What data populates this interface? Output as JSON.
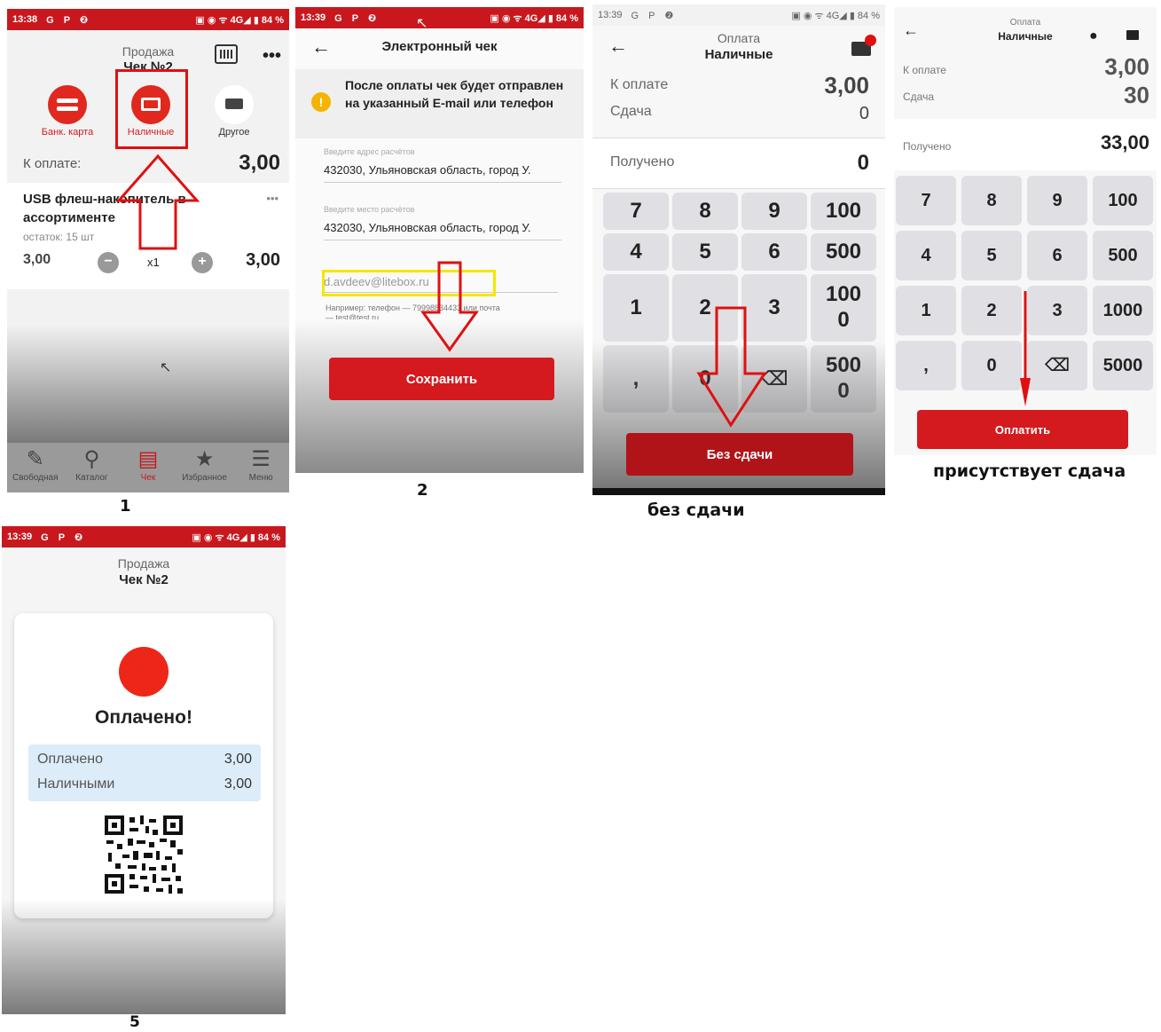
{
  "panel1": {
    "status_time": "13:38",
    "status_icons": "G P ❷",
    "status_right": "▣ ◉ ᯤ 4G◢ ▮ 84 %",
    "title": "Продажа",
    "subtitle": "Чек №2",
    "payment_methods": [
      "Банк. карта",
      "Наличные",
      "Другое"
    ],
    "to_pay_label": "К оплате:",
    "to_pay_value": "3,00",
    "item_name": "USB флеш-накопитель в ассортименте",
    "item_stock": "остаток: 15 шт",
    "item_price": "3,00",
    "item_qty": "x1",
    "item_total": "3,00",
    "tabs": [
      "Свободная",
      "Каталог",
      "Чек",
      "Избранное",
      "Меню"
    ],
    "caption": "1"
  },
  "panel2": {
    "status_time": "13:39",
    "status_icons": "G P ❷",
    "status_right": "▣ ◉ ᯤ 4G◢ ▮ 84 %",
    "title": "Электронный чек",
    "notice": "После оплаты чек будет отправлен на указанный E-mail или телефон",
    "field1_label": "Введите адрес расчётов",
    "field1_value": "432030, Ульяновская область, город У.",
    "field2_label": "Введите место расчётов",
    "field2_value": "432030, Ульяновская область, город У.",
    "email_value": "d.avdeev@litebox.ru",
    "hint": "Например: телефон — 79998834433 или почта — test@test.ru",
    "save_button": "Сохранить",
    "caption": "2"
  },
  "panel3": {
    "status_time": "13:39",
    "status_icons": "G P ❷",
    "status_right": "▣ ◉ ᯤ 4G◢ ▮ 84 %",
    "title": "Оплата",
    "subtitle": "Наличные",
    "to_pay_label": "К оплате",
    "to_pay_value": "3,00",
    "change_label": "Сдача",
    "change_value": "0",
    "received_label": "Получено",
    "received_value": "0",
    "keys": [
      "7",
      "8",
      "9",
      "100",
      "4",
      "5",
      "6",
      "500",
      "1",
      "2",
      "3",
      "1000",
      ",",
      "0",
      "⌫",
      "5000"
    ],
    "button": "Без сдачи",
    "caption": "без сдачи"
  },
  "panel4": {
    "title": "Оплата",
    "subtitle": "Наличные",
    "to_pay_label": "К оплате",
    "to_pay_value": "3,00",
    "change_label": "Сдача",
    "change_value": "30",
    "received_label": "Получено",
    "received_value": "33,00",
    "keys": [
      "7",
      "8",
      "9",
      "100",
      "4",
      "5",
      "6",
      "500",
      "1",
      "2",
      "3",
      "1000",
      ",",
      "0",
      "⌫",
      "5000"
    ],
    "button": "Оплатить",
    "caption": "присутствует сдача"
  },
  "panel5": {
    "status_time": "13:39",
    "status_icons": "G P ❷",
    "status_right": "▣ ◉ ᯤ 4G◢ ▮ 84 %",
    "title": "Продажа",
    "subtitle": "Чек №2",
    "paid_title": "Оплачено!",
    "paid_label": "Оплачено",
    "paid_value": "3,00",
    "cash_label": "Наличными",
    "cash_value": "3,00",
    "caption": "5"
  },
  "colors": {
    "accent": "#d41a1f",
    "status": "#c8181e",
    "highlight_yellow": "#f5e600",
    "info_bg": "#dcecf8"
  }
}
